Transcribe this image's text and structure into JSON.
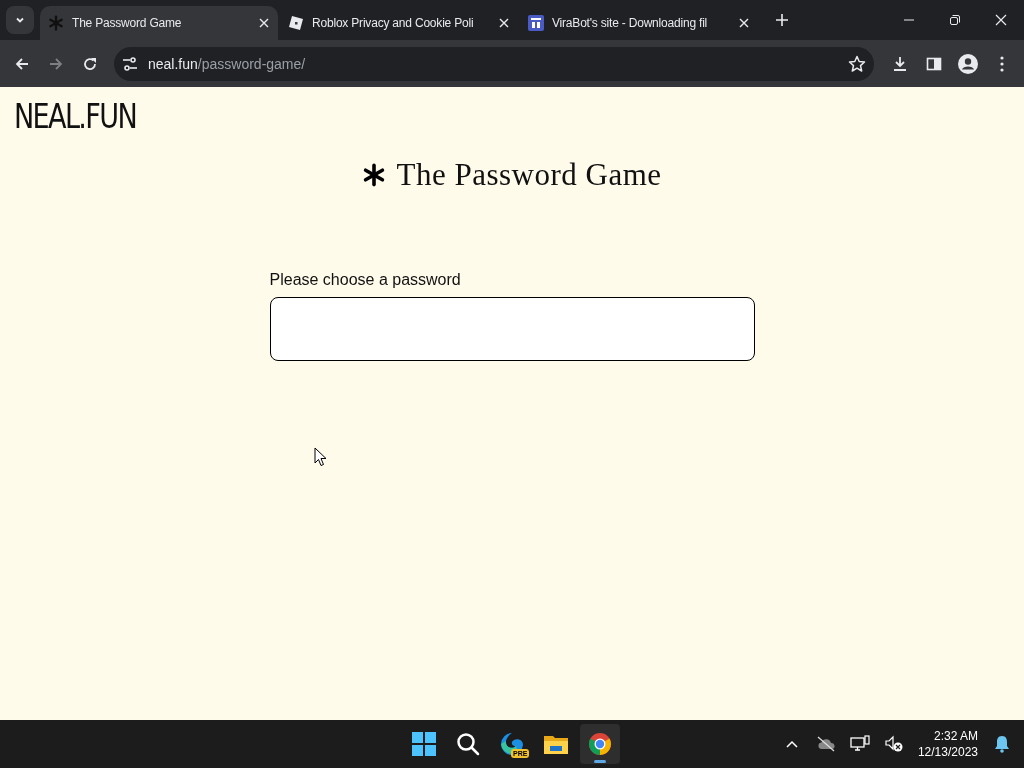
{
  "browser": {
    "tabs": [
      {
        "title": "The Password Game",
        "kind": "asterisk",
        "selected": true
      },
      {
        "title": "Roblox Privacy and Cookie Poli",
        "kind": "tilted-square",
        "selected": false
      },
      {
        "title": "ViraBot's site - Downloading fil",
        "kind": "site-window",
        "selected": false
      }
    ],
    "address_host": "neal.fun",
    "address_path": "/password-game/"
  },
  "page": {
    "logo": "NEAL.FUN",
    "title": "The Password Game",
    "field_label": "Please choose a password"
  },
  "taskbar": {
    "apps": [
      {
        "kind": "start",
        "active": false
      },
      {
        "kind": "search",
        "active": false
      },
      {
        "kind": "edge",
        "badge": "PRE",
        "active": false
      },
      {
        "kind": "folder",
        "active": false
      },
      {
        "kind": "chrome",
        "active": true
      }
    ],
    "time": "2:32 AM",
    "date": "12/13/2023"
  }
}
